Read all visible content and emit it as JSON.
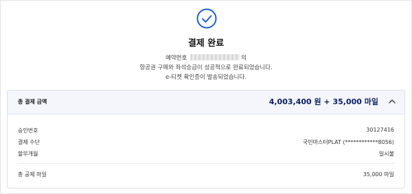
{
  "icon": "check-circle-icon",
  "colors": {
    "accent": "#1f5bd6",
    "amount": "#0a1f5c"
  },
  "title": "결제 완료",
  "message": {
    "reservation_prefix": "예약번호",
    "reservation_suffix": "의",
    "line2": "항공권 구매와 좌석승급이 성공적으로 완료되었습니다.",
    "line3": "e-티켓 확인증이 발송되었습니다."
  },
  "summary": {
    "label": "총 결제 금액",
    "amount": "4,003,400 원 + 35,000 마일",
    "toggle_icon": "chevron-up-icon"
  },
  "details": {
    "approval_label": "승인번호",
    "approval_value": "30127416",
    "method_label": "결제 수단",
    "method_value": "국민마스터PLAT (************8056)",
    "installment_label": "할부개월",
    "installment_value": "일시불",
    "miles_label": "총 공제 마일",
    "miles_value": "35,000 마일"
  }
}
